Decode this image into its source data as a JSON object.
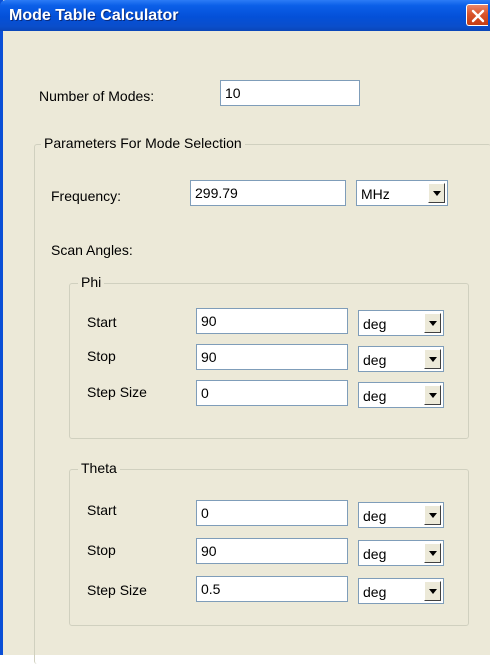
{
  "window": {
    "title": "Mode Table Calculator"
  },
  "num_modes": {
    "label": "Number of Modes:",
    "value": "10"
  },
  "params_group": {
    "title": "Parameters For Mode Selection"
  },
  "frequency": {
    "label": "Frequency:",
    "value": "299.79",
    "unit": "MHz"
  },
  "scan_angles": {
    "label": "Scan Angles:"
  },
  "phi": {
    "title": "Phi",
    "start": {
      "label": "Start",
      "value": "90",
      "unit": "deg"
    },
    "stop": {
      "label": "Stop",
      "value": "90",
      "unit": "deg"
    },
    "step": {
      "label": "Step Size",
      "value": "0",
      "unit": "deg"
    }
  },
  "theta": {
    "title": "Theta",
    "start": {
      "label": "Start",
      "value": "0",
      "unit": "deg"
    },
    "stop": {
      "label": "Stop",
      "value": "90",
      "unit": "deg"
    },
    "step": {
      "label": "Step Size",
      "value": "0.5",
      "unit": "deg"
    }
  }
}
